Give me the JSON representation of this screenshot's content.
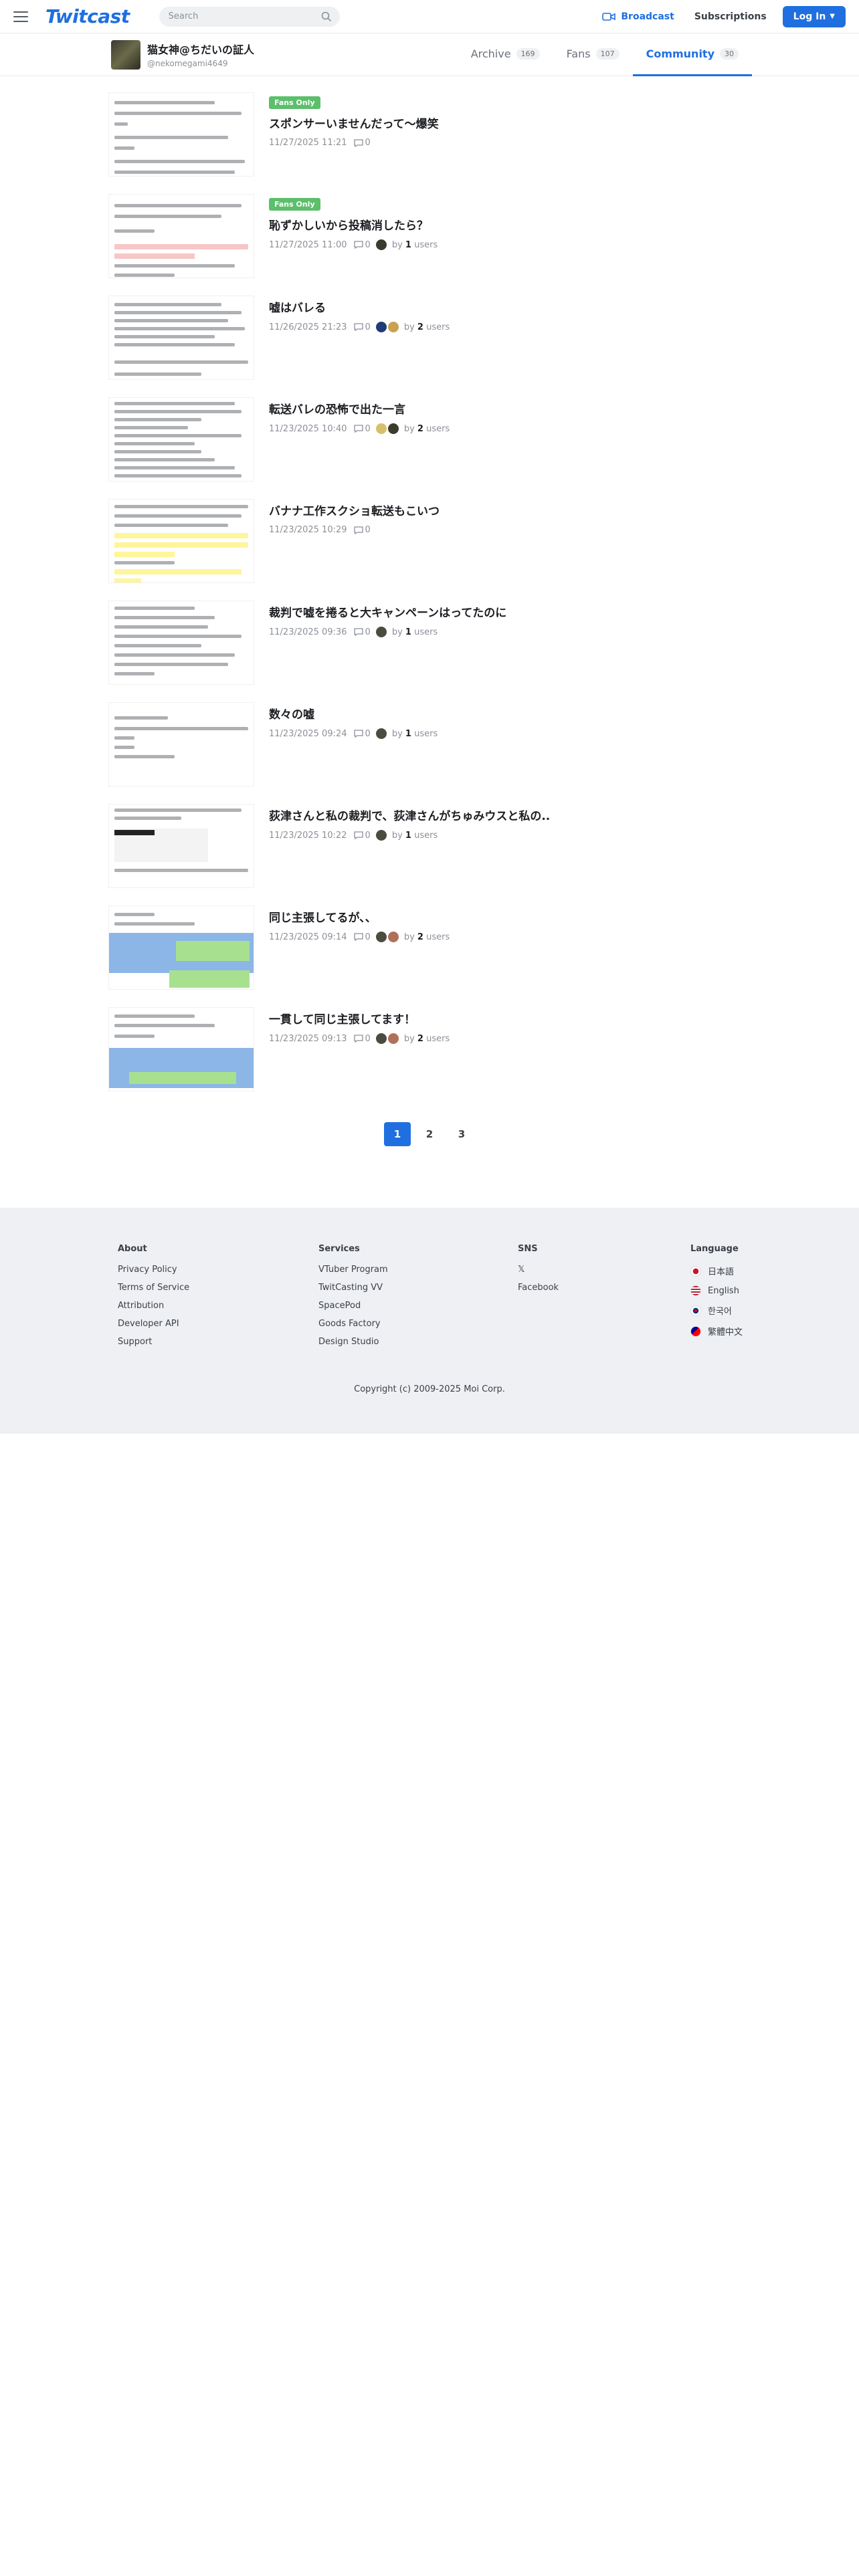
{
  "header": {
    "logo": "Twitcast",
    "search_placeholder": "Search",
    "broadcast_label": "Broadcast",
    "subscriptions_label": "Subscriptions",
    "login_label": "Log In"
  },
  "profile": {
    "name": "猫女神@ちだいの証人",
    "handle": "@nekomegami4649"
  },
  "tabs": [
    {
      "label": "Archive",
      "count": "169"
    },
    {
      "label": "Fans",
      "count": "107"
    },
    {
      "label": "Community",
      "count": "30"
    }
  ],
  "posts": [
    {
      "fans_only": "Fans Only",
      "title": "スポンサーいませんだって〜爆笑",
      "date": "11/27/2025 11:21",
      "comments": "0"
    },
    {
      "fans_only": "Fans Only",
      "title": "恥ずかしいから投稿消したら？",
      "date": "11/27/2025 11:00",
      "comments": "0",
      "by": "by",
      "users": "1",
      "users_label": "users"
    },
    {
      "title": "嘘はバレる",
      "date": "11/26/2025 21:23",
      "comments": "0",
      "by": "by",
      "users": "2",
      "users_label": "users"
    },
    {
      "title": "転送バレの恐怖で出た一言",
      "date": "11/23/2025 10:40",
      "comments": "0",
      "by": "by",
      "users": "2",
      "users_label": "users"
    },
    {
      "title": "バナナ工作スクショ転送もこいつ",
      "date": "11/23/2025 10:29",
      "comments": "0"
    },
    {
      "title": "裁判で嘘を捲ると大キャンペーンはってたのに",
      "date": "11/23/2025 09:36",
      "comments": "0",
      "by": "by",
      "users": "1",
      "users_label": "users"
    },
    {
      "title": "数々の嘘",
      "date": "11/23/2025 09:24",
      "comments": "0",
      "by": "by",
      "users": "1",
      "users_label": "users"
    },
    {
      "title": "荻津さんと私の裁判で、荻津さんがちゅみウスと私の..",
      "date": "11/23/2025 10:22",
      "comments": "0",
      "by": "by",
      "users": "1",
      "users_label": "users"
    },
    {
      "title": "同じ主張してるが、、",
      "date": "11/23/2025 09:14",
      "comments": "0",
      "by": "by",
      "users": "2",
      "users_label": "users"
    },
    {
      "title": "一貫して同じ主張してます！",
      "date": "11/23/2025 09:13",
      "comments": "0",
      "by": "by",
      "users": "2",
      "users_label": "users"
    }
  ],
  "pagination": [
    "1",
    "2",
    "3"
  ],
  "footer": {
    "about": {
      "heading": "About",
      "links": [
        "Privacy Policy",
        "Terms of Service",
        "Attribution",
        "Developer API",
        "Support"
      ]
    },
    "services": {
      "heading": "Services",
      "links": [
        "VTuber Program",
        "TwitCasting VV",
        "SpacePod",
        "Goods Factory",
        "Design Studio"
      ]
    },
    "sns": {
      "heading": "SNS",
      "links": [
        "𝕏",
        "Facebook"
      ]
    },
    "language": {
      "heading": "Language",
      "links": [
        "日本語",
        "English",
        "한국어",
        "繁體中文"
      ]
    },
    "copyright": "Copyright (c) 2009-2025 Moi Corp."
  },
  "colors": {
    "accent": "#1f6fe0",
    "fans_badge": "#5cbf6b"
  }
}
